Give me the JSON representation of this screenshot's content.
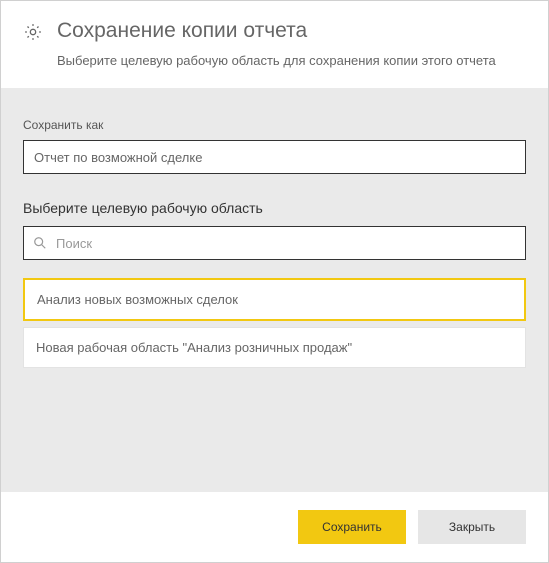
{
  "header": {
    "title": "Сохранение копии отчета",
    "subtitle": "Выберите целевую рабочую область для сохранения копии этого отчета"
  },
  "form": {
    "save_as_label": "Сохранить как",
    "save_as_value": "Отчет по возможной сделке",
    "workspace_label": "Выберите целевую рабочую область",
    "search_placeholder": "Поиск"
  },
  "workspaces": {
    "items": [
      {
        "label": "Анализ новых возможных сделок"
      },
      {
        "label": "Новая рабочая область \"Анализ розничных продаж\""
      }
    ]
  },
  "footer": {
    "save_label": "Сохранить",
    "close_label": "Закрыть"
  },
  "colors": {
    "accent": "#f2c811"
  }
}
